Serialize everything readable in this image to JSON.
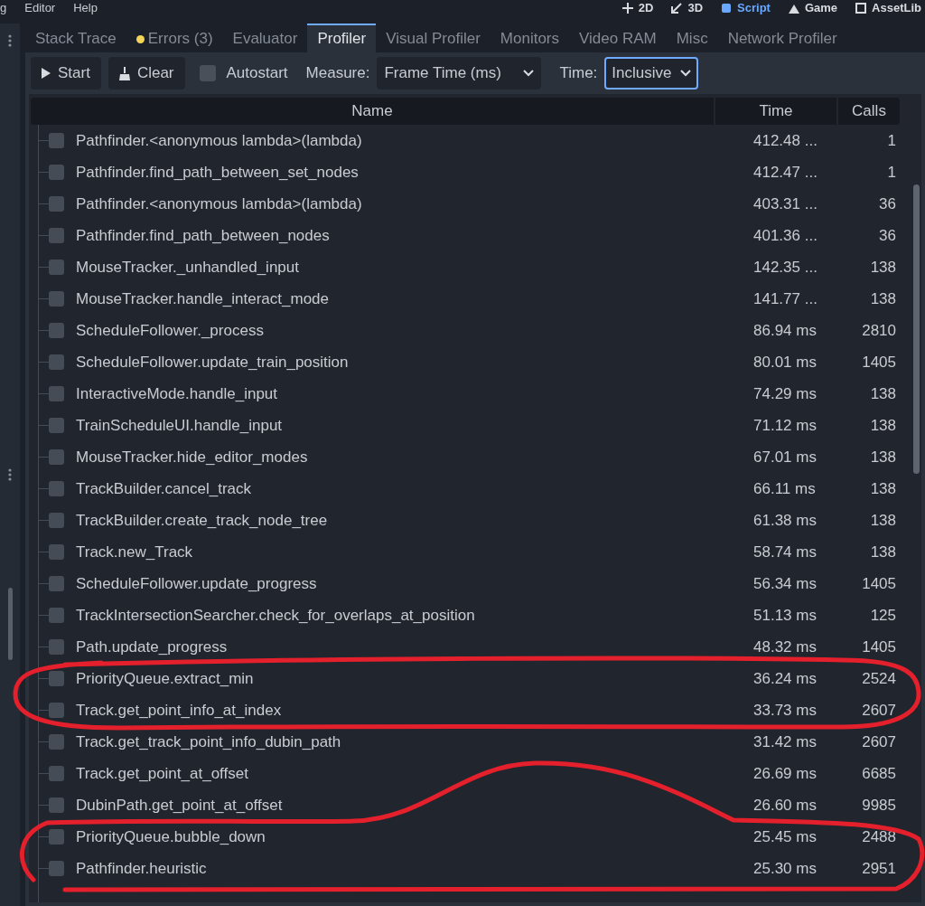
{
  "menu_bar": {
    "items": [
      {
        "label": "g"
      },
      {
        "label": "Editor"
      },
      {
        "label": "Help"
      }
    ],
    "workspaces": [
      {
        "kind": "planar",
        "label": "2D",
        "selected": false
      },
      {
        "kind": "spatial",
        "label": "3D",
        "selected": false
      },
      {
        "kind": "script",
        "label": "Script",
        "selected": true
      },
      {
        "kind": "game",
        "label": "Game",
        "selected": false
      },
      {
        "kind": "assetlib",
        "label": "AssetLib",
        "selected": false
      }
    ]
  },
  "tabs": [
    {
      "label": "Stack Trace",
      "selected": false
    },
    {
      "label": "Errors (3)",
      "selected": false,
      "color": "#f5d45a"
    },
    {
      "label": "Evaluator",
      "selected": false
    },
    {
      "label": "Profiler",
      "selected": true
    },
    {
      "label": "Visual Profiler",
      "selected": false
    },
    {
      "label": "Monitors",
      "selected": false
    },
    {
      "label": "Video RAM",
      "selected": false
    },
    {
      "label": "Misc",
      "selected": false
    },
    {
      "label": "Network Profiler",
      "selected": false
    }
  ],
  "toolbar": {
    "start": "Start",
    "clear": "Clear",
    "autostart": {
      "label": "Autostart",
      "checked": false
    },
    "measure": {
      "label": "Measure:",
      "value": "Frame Time (ms)"
    },
    "time": {
      "label": "Time:",
      "value": "Inclusive",
      "focused": true
    }
  },
  "table": {
    "columns": [
      "Name",
      "Time",
      "Calls"
    ],
    "rows": [
      {
        "name": "Pathfinder.<anonymous lambda>(lambda)",
        "time": "412.48 ...",
        "calls": "1",
        "checked": false
      },
      {
        "name": "Pathfinder.find_path_between_set_nodes",
        "time": "412.47 ...",
        "calls": "1",
        "checked": false
      },
      {
        "name": "Pathfinder.<anonymous lambda>(lambda)",
        "time": "403.31 ...",
        "calls": "36",
        "checked": false
      },
      {
        "name": "Pathfinder.find_path_between_nodes",
        "time": "401.36 ...",
        "calls": "36",
        "checked": false
      },
      {
        "name": "MouseTracker._unhandled_input",
        "time": "142.35 ...",
        "calls": "138",
        "checked": false
      },
      {
        "name": "MouseTracker.handle_interact_mode",
        "time": "141.77 ...",
        "calls": "138",
        "checked": false
      },
      {
        "name": "ScheduleFollower._process",
        "time": "86.94 ms",
        "calls": "2810",
        "checked": false
      },
      {
        "name": "ScheduleFollower.update_train_position",
        "time": "80.01 ms",
        "calls": "1405",
        "checked": false
      },
      {
        "name": "InteractiveMode.handle_input",
        "time": "74.29 ms",
        "calls": "138",
        "checked": false
      },
      {
        "name": "TrainScheduleUI.handle_input",
        "time": "71.12 ms",
        "calls": "138",
        "checked": false
      },
      {
        "name": "MouseTracker.hide_editor_modes",
        "time": "67.01 ms",
        "calls": "138",
        "checked": false
      },
      {
        "name": "TrackBuilder.cancel_track",
        "time": "66.11 ms",
        "calls": "138",
        "checked": false
      },
      {
        "name": "TrackBuilder.create_track_node_tree",
        "time": "61.38 ms",
        "calls": "138",
        "checked": false
      },
      {
        "name": "Track.new_Track",
        "time": "58.74 ms",
        "calls": "138",
        "checked": false
      },
      {
        "name": "ScheduleFollower.update_progress",
        "time": "56.34 ms",
        "calls": "1405",
        "checked": false
      },
      {
        "name": "TrackIntersectionSearcher.check_for_overlaps_at_position",
        "time": "51.13 ms",
        "calls": "125",
        "checked": false
      },
      {
        "name": "Path.update_progress",
        "time": "48.32 ms",
        "calls": "1405",
        "checked": false
      },
      {
        "name": "PriorityQueue.extract_min",
        "time": "36.24 ms",
        "calls": "2524",
        "checked": false
      },
      {
        "name": "Track.get_point_info_at_index",
        "time": "33.73 ms",
        "calls": "2607",
        "checked": false
      },
      {
        "name": "Track.get_track_point_info_dubin_path",
        "time": "31.42 ms",
        "calls": "2607",
        "checked": false
      },
      {
        "name": "Track.get_point_at_offset",
        "time": "26.69 ms",
        "calls": "6685",
        "checked": false
      },
      {
        "name": "DubinPath.get_point_at_offset",
        "time": "26.60 ms",
        "calls": "9985",
        "checked": false
      },
      {
        "name": "PriorityQueue.bubble_down",
        "time": "25.45 ms",
        "calls": "2488",
        "checked": false
      },
      {
        "name": "Pathfinder.heuristic",
        "time": "25.30 ms",
        "calls": "2951",
        "checked": false
      }
    ]
  },
  "ink_annotations": [
    {
      "kind": "loop",
      "color": "#e3202c"
    },
    {
      "kind": "wide-loop",
      "color": "#e3202c"
    }
  ]
}
